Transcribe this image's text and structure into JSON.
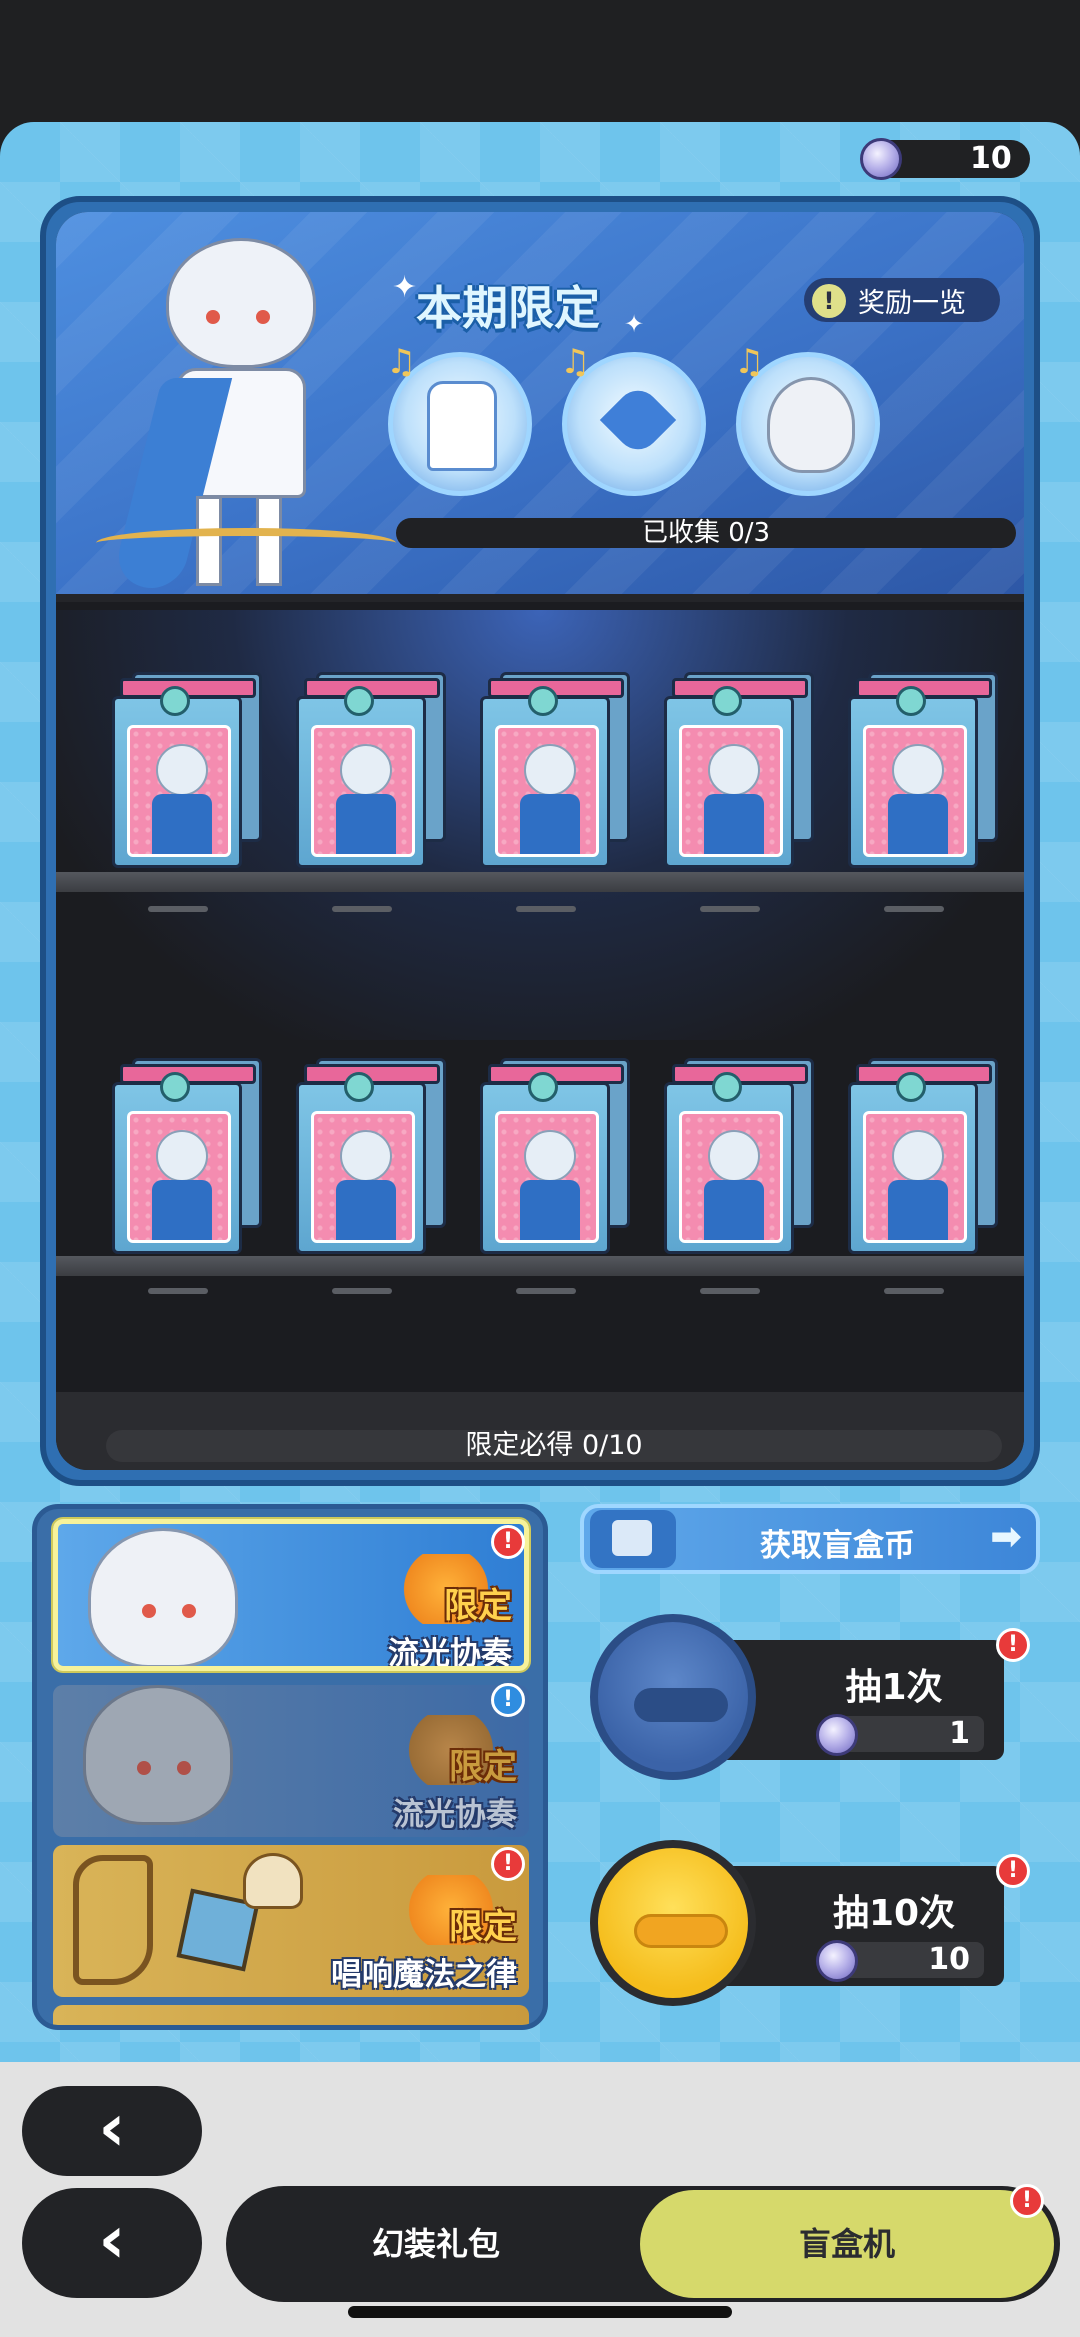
{
  "currency": {
    "amount": "10",
    "icon": "blind-box-coin-icon"
  },
  "banner": {
    "title": "本期限定",
    "rewards_button": "奖励一览",
    "collected_label": "已收集 0/3",
    "reward_items": [
      "outfit-icon",
      "hair-accessory-icon",
      "hairstyle-icon"
    ]
  },
  "shelves": {
    "guarantee_label": "限定必得 0/10",
    "rows": 2,
    "boxes_per_row": 5
  },
  "pools": [
    {
      "tag": "限定",
      "name": "流光协奏",
      "state": "selected",
      "badge": "!"
    },
    {
      "tag": "限定",
      "name": "流光协奏",
      "state": "dimmed",
      "badge": "!"
    },
    {
      "tag": "限定",
      "name": "唱响魔法之律",
      "state": "normal",
      "badge": "!"
    }
  ],
  "get_coins_label": "获取盲盒币",
  "draw_buttons": [
    {
      "title": "抽1次",
      "cost": "1",
      "badge": "!"
    },
    {
      "title": "抽10次",
      "cost": "10",
      "badge": "!"
    }
  ],
  "nav": {
    "back_icon": "‹",
    "tabs": [
      {
        "label": "幻装礼包",
        "active": false
      },
      {
        "label": "盲盒机",
        "active": true,
        "badge": "!"
      }
    ]
  },
  "colors": {
    "panel": "#6ec4ec",
    "active_tab": "#d6d96b",
    "alert": "#e83a3a"
  }
}
